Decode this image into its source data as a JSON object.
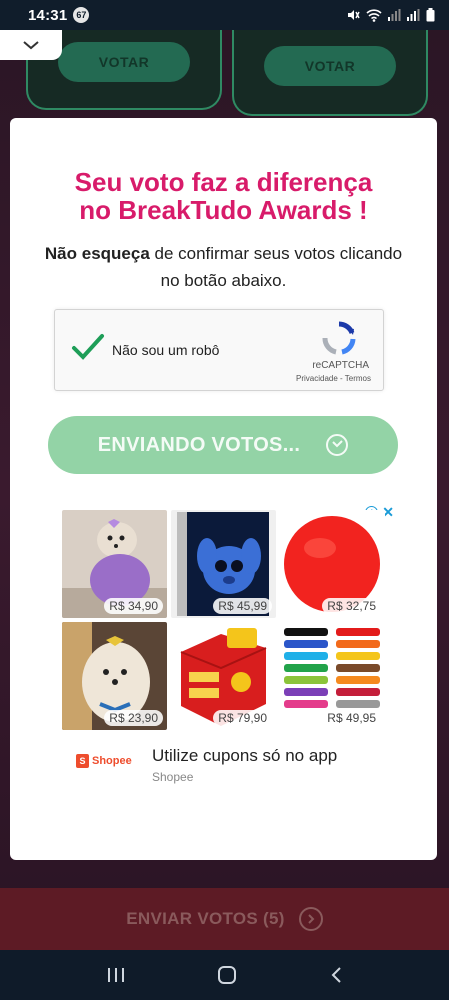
{
  "status_bar": {
    "time": "14:31",
    "badge": "67"
  },
  "background": {
    "vote_left": "VOTAR",
    "vote_right": "VOTAR",
    "send_button": "ENVIAR VOTOS (5)"
  },
  "modal": {
    "title_line1": "Seu voto faz a diferença",
    "title_line2": "no BreakTudo Awards !",
    "subtitle_bold": "Não esqueça",
    "subtitle_rest": " de confirmar seus votos clicando no botão abaixo.",
    "recaptcha": {
      "label": "Não sou um robô",
      "brand": "reCAPTCHA",
      "links": "Privacidade - Termos",
      "checked": true
    },
    "sending_button": "ENVIANDO VOTOS..."
  },
  "ad": {
    "prices": [
      "R$ 34,90",
      "R$ 45,99",
      "R$ 32,75",
      "R$ 23,90",
      "R$ 79,90",
      "R$ 49,95"
    ],
    "headline": "Utilize cupons só no app",
    "advertiser": "Shopee",
    "logo_text": "Shopee"
  },
  "colors": {
    "title": "#d81b6a",
    "sending_button": "#93d3a6",
    "send_bar": "#5d1b25",
    "vote_button": "#236a52"
  }
}
